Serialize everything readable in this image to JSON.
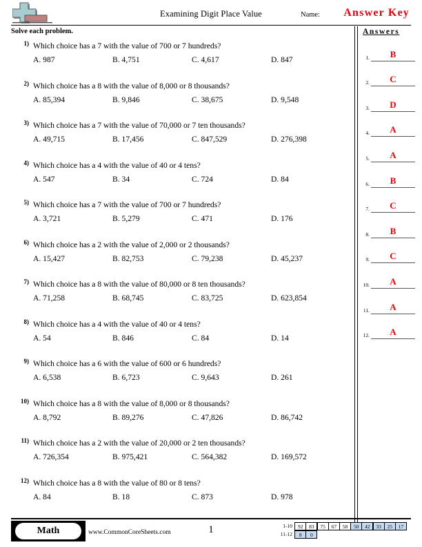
{
  "header": {
    "title": "Examining Digit Place Value",
    "name_label": "Name:",
    "answer_key": "Answer Key",
    "logo": "math-plus-logo",
    "instructions": "Solve each problem."
  },
  "answers_panel": {
    "heading": "Answers",
    "rows": [
      {
        "num": "1.",
        "value": "B"
      },
      {
        "num": "2.",
        "value": "C"
      },
      {
        "num": "3.",
        "value": "D"
      },
      {
        "num": "4.",
        "value": "A"
      },
      {
        "num": "5.",
        "value": "A"
      },
      {
        "num": "6.",
        "value": "B"
      },
      {
        "num": "7.",
        "value": "C"
      },
      {
        "num": "8.",
        "value": "B"
      },
      {
        "num": "9.",
        "value": "C"
      },
      {
        "num": "10.",
        "value": "A"
      },
      {
        "num": "11.",
        "value": "A"
      },
      {
        "num": "12.",
        "value": "A"
      }
    ],
    "answer_color": "#e8000b"
  },
  "problems": [
    {
      "num": "1)",
      "question": "Which choice has a 7 with the value of 700 or 7 hundreds?",
      "choices": [
        "A. 987",
        "B. 4,751",
        "C. 4,617",
        "D. 847"
      ]
    },
    {
      "num": "2)",
      "question": "Which choice has a 8 with the value of 8,000 or 8 thousands?",
      "choices": [
        "A. 85,394",
        "B. 9,846",
        "C. 38,675",
        "D. 9,548"
      ]
    },
    {
      "num": "3)",
      "question": "Which choice has a 7 with the value of 70,000 or 7 ten thousands?",
      "choices": [
        "A. 49,715",
        "B. 17,456",
        "C. 847,529",
        "D. 276,398"
      ]
    },
    {
      "num": "4)",
      "question": "Which choice has a 4 with the value of 40 or 4 tens?",
      "choices": [
        "A. 547",
        "B. 34",
        "C. 724",
        "D. 84"
      ]
    },
    {
      "num": "5)",
      "question": "Which choice has a 7 with the value of 700 or 7 hundreds?",
      "choices": [
        "A. 3,721",
        "B. 5,279",
        "C. 471",
        "D. 176"
      ]
    },
    {
      "num": "6)",
      "question": "Which choice has a 2 with the value of 2,000 or 2 thousands?",
      "choices": [
        "A. 15,427",
        "B. 82,753",
        "C. 79,238",
        "D. 45,237"
      ]
    },
    {
      "num": "7)",
      "question": "Which choice has a 8 with the value of 80,000 or 8 ten thousands?",
      "choices": [
        "A. 71,258",
        "B. 68,745",
        "C. 83,725",
        "D. 623,854"
      ]
    },
    {
      "num": "8)",
      "question": "Which choice has a 4 with the value of 40 or 4 tens?",
      "choices": [
        "A. 54",
        "B. 846",
        "C. 84",
        "D. 14"
      ]
    },
    {
      "num": "9)",
      "question": "Which choice has a 6 with the value of 600 or 6 hundreds?",
      "choices": [
        "A. 6,538",
        "B. 6,723",
        "C. 9,643",
        "D. 261"
      ]
    },
    {
      "num": "10)",
      "question": "Which choice has a 8 with the value of 8,000 or 8 thousands?",
      "choices": [
        "A. 8,792",
        "B. 89,276",
        "C. 47,826",
        "D. 86,742"
      ]
    },
    {
      "num": "11)",
      "question": "Which choice has a 2 with the value of 20,000 or 2 ten thousands?",
      "choices": [
        "A. 726,354",
        "B. 975,421",
        "C. 564,382",
        "D. 169,572"
      ]
    },
    {
      "num": "12)",
      "question": "Which choice has a 8 with the value of 80 or 8 tens?",
      "choices": [
        "A. 84",
        "B. 18",
        "C. 873",
        "D. 978"
      ]
    }
  ],
  "footer": {
    "subject": "Math",
    "url": "www.CommonCoreSheets.com",
    "page_number": "1",
    "grading_scale": {
      "row1_label": "1-10",
      "row2_label": "11-12",
      "row1": [
        {
          "value": "92",
          "highlighted": false
        },
        {
          "value": "83",
          "highlighted": false
        },
        {
          "value": "75",
          "highlighted": false
        },
        {
          "value": "67",
          "highlighted": false
        },
        {
          "value": "58",
          "highlighted": false
        },
        {
          "value": "50",
          "highlighted": true
        },
        {
          "value": "42",
          "highlighted": true
        },
        {
          "value": "33",
          "highlighted": true
        },
        {
          "value": "25",
          "highlighted": true
        },
        {
          "value": "17",
          "highlighted": true
        }
      ],
      "row2": [
        {
          "value": "8",
          "highlighted": true
        },
        {
          "value": "0",
          "highlighted": true
        }
      ],
      "highlight_color": "#c5d9f1"
    }
  }
}
